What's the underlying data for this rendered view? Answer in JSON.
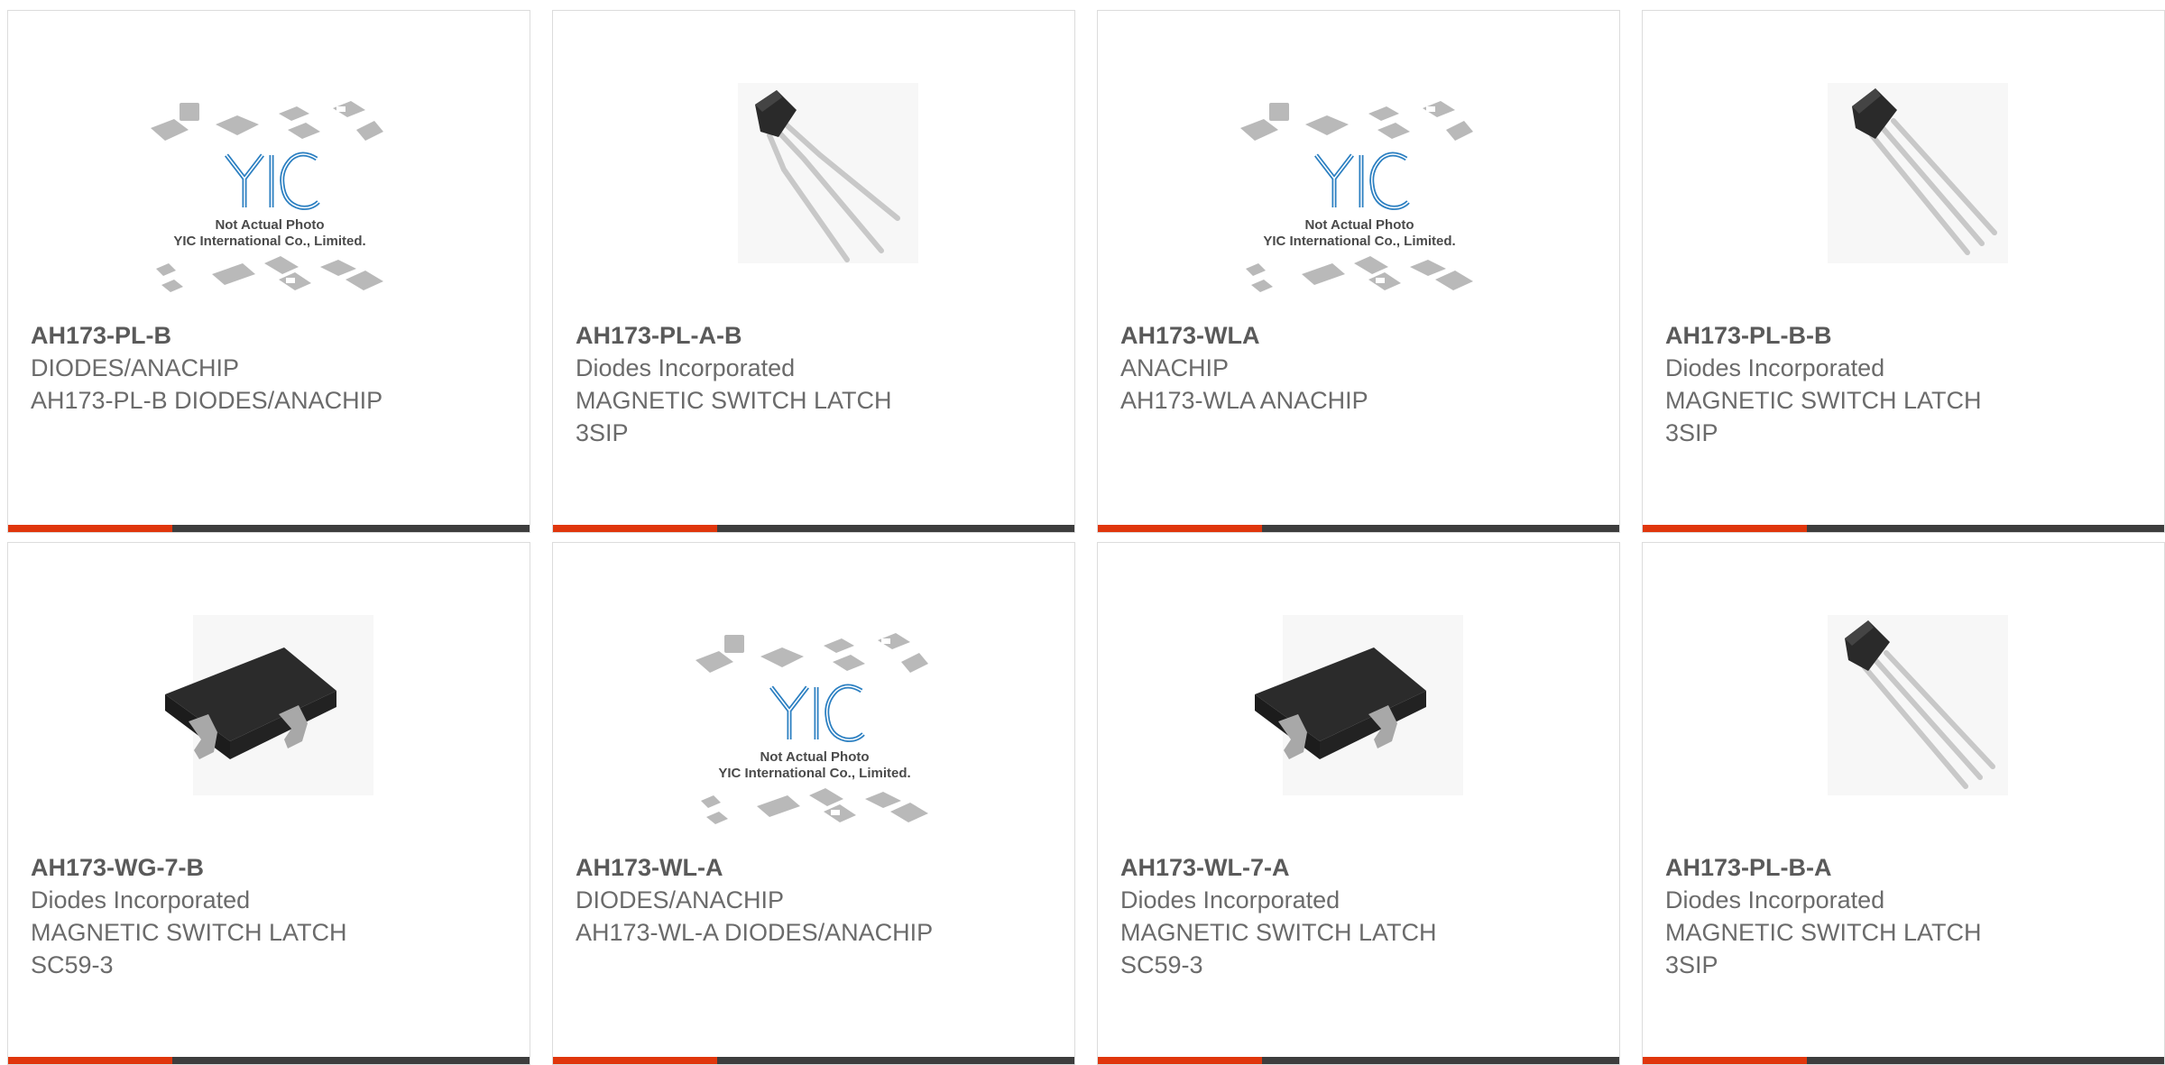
{
  "products": [
    {
      "part": "AH173-PL-B",
      "lines": [
        "DIODES/ANACHIP",
        "AH173-PL-B DIODES/ANACHIP"
      ],
      "image": "yic-placeholder",
      "placeholder_text": [
        "Not Actual Photo",
        "YIC International Co., Limited."
      ],
      "logo_text": "YIC"
    },
    {
      "part": "AH173-PL-A-B",
      "lines": [
        "Diodes Incorporated",
        "MAGNETIC SWITCH LATCH",
        "3SIP"
      ],
      "image": "sip3-bent"
    },
    {
      "part": "AH173-WLA",
      "lines": [
        "ANACHIP",
        "AH173-WLA ANACHIP"
      ],
      "image": "yic-placeholder",
      "placeholder_text": [
        "Not Actual Photo",
        "YIC International Co., Limited."
      ],
      "logo_text": "YIC"
    },
    {
      "part": "AH173-PL-B-B",
      "lines": [
        "Diodes Incorporated",
        "MAGNETIC SWITCH LATCH",
        "3SIP"
      ],
      "image": "sip3-straight"
    },
    {
      "part": "AH173-WG-7-B",
      "lines": [
        "Diodes Incorporated",
        "MAGNETIC SWITCH LATCH",
        "SC59-3"
      ],
      "image": "sc59"
    },
    {
      "part": "AH173-WL-A",
      "lines": [
        "DIODES/ANACHIP",
        "AH173-WL-A DIODES/ANACHIP"
      ],
      "image": "yic-placeholder",
      "placeholder_text": [
        "Not Actual Photo",
        "YIC International Co., Limited."
      ],
      "logo_text": "YIC"
    },
    {
      "part": "AH173-WL-7-A",
      "lines": [
        "Diodes Incorporated",
        "MAGNETIC SWITCH LATCH",
        "SC59-3"
      ],
      "image": "sc59"
    },
    {
      "part": "AH173-PL-B-A",
      "lines": [
        "Diodes Incorporated",
        "MAGNETIC SWITCH LATCH",
        "3SIP"
      ],
      "image": "sip3-straight"
    }
  ],
  "colors": {
    "accent": "#e0360c",
    "bar": "#3d3d3d",
    "text": "#6b6b6b",
    "logo": "#2b7fc1"
  }
}
